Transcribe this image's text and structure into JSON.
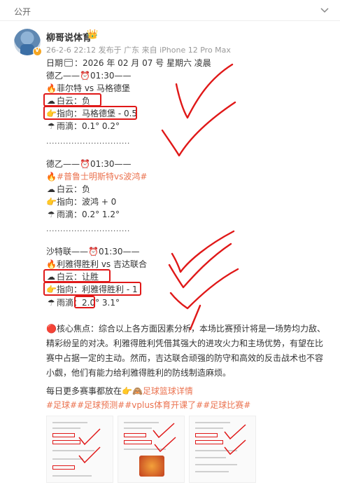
{
  "header": {
    "visibility": "公开"
  },
  "post": {
    "author": "柳哥说体育",
    "meta": "26-2-6 22:12  发布于 广东  来自 iPhone 12 Pro Max",
    "date_prefix": "日期",
    "date_text": "：2026 年 02 月 07 号  星期六  凌晨",
    "matches": [
      {
        "league_line": "德乙——⏰01:30——",
        "teams": "菲尔特 vs 马格德堡",
        "baiyun": "白云：负",
        "zhixiang": "指向：马格德堡 - 0.5",
        "yudi": "雨滴：0.1°  0.2°"
      },
      {
        "league_line": "德乙——⏰01:30——",
        "teams": "#普鲁士明斯特vs波鸿#",
        "baiyun": "白云：负",
        "zhixiang": "指向：波鸿 + 0",
        "yudi": "雨滴：0.2°  1.2°"
      },
      {
        "league_line": "沙特联——⏰01:30——",
        "teams": "利雅得胜利 vs 吉达联合",
        "baiyun": "白云：让胜",
        "zhixiang": "指向：利雅得胜利 - 1",
        "yudi_label": "雨滴：",
        "yudi_v1": "2.0°",
        "yudi_v2": " 3.1°"
      }
    ],
    "separator": "..............................",
    "analysis": "🔴核心焦点：综合以上各方面因素分析，本场比赛预计将是一场势均力敌、精彩纷呈的对决。利雅得胜利凭借其强大的进攻火力和主场优势，有望在比赛中占据一定的主动。然而，吉达联合顽强的防守和高效的反击战术也不容小觑，他们有能力给利雅得胜利的防线制造麻烦。",
    "promo_text": "每日更多赛事都放在",
    "promo_link": "🙈足球篮球详情",
    "hashtags": "#足球##足球预测##vplus体育开课了##足球比赛#"
  },
  "icons": {
    "fire": "🔥",
    "cloud": "☁",
    "point": "👉",
    "umbrella": "☂",
    "crown": "👑"
  },
  "colors": {
    "accent": "#eb7350",
    "annotation_red": "#e01818"
  }
}
